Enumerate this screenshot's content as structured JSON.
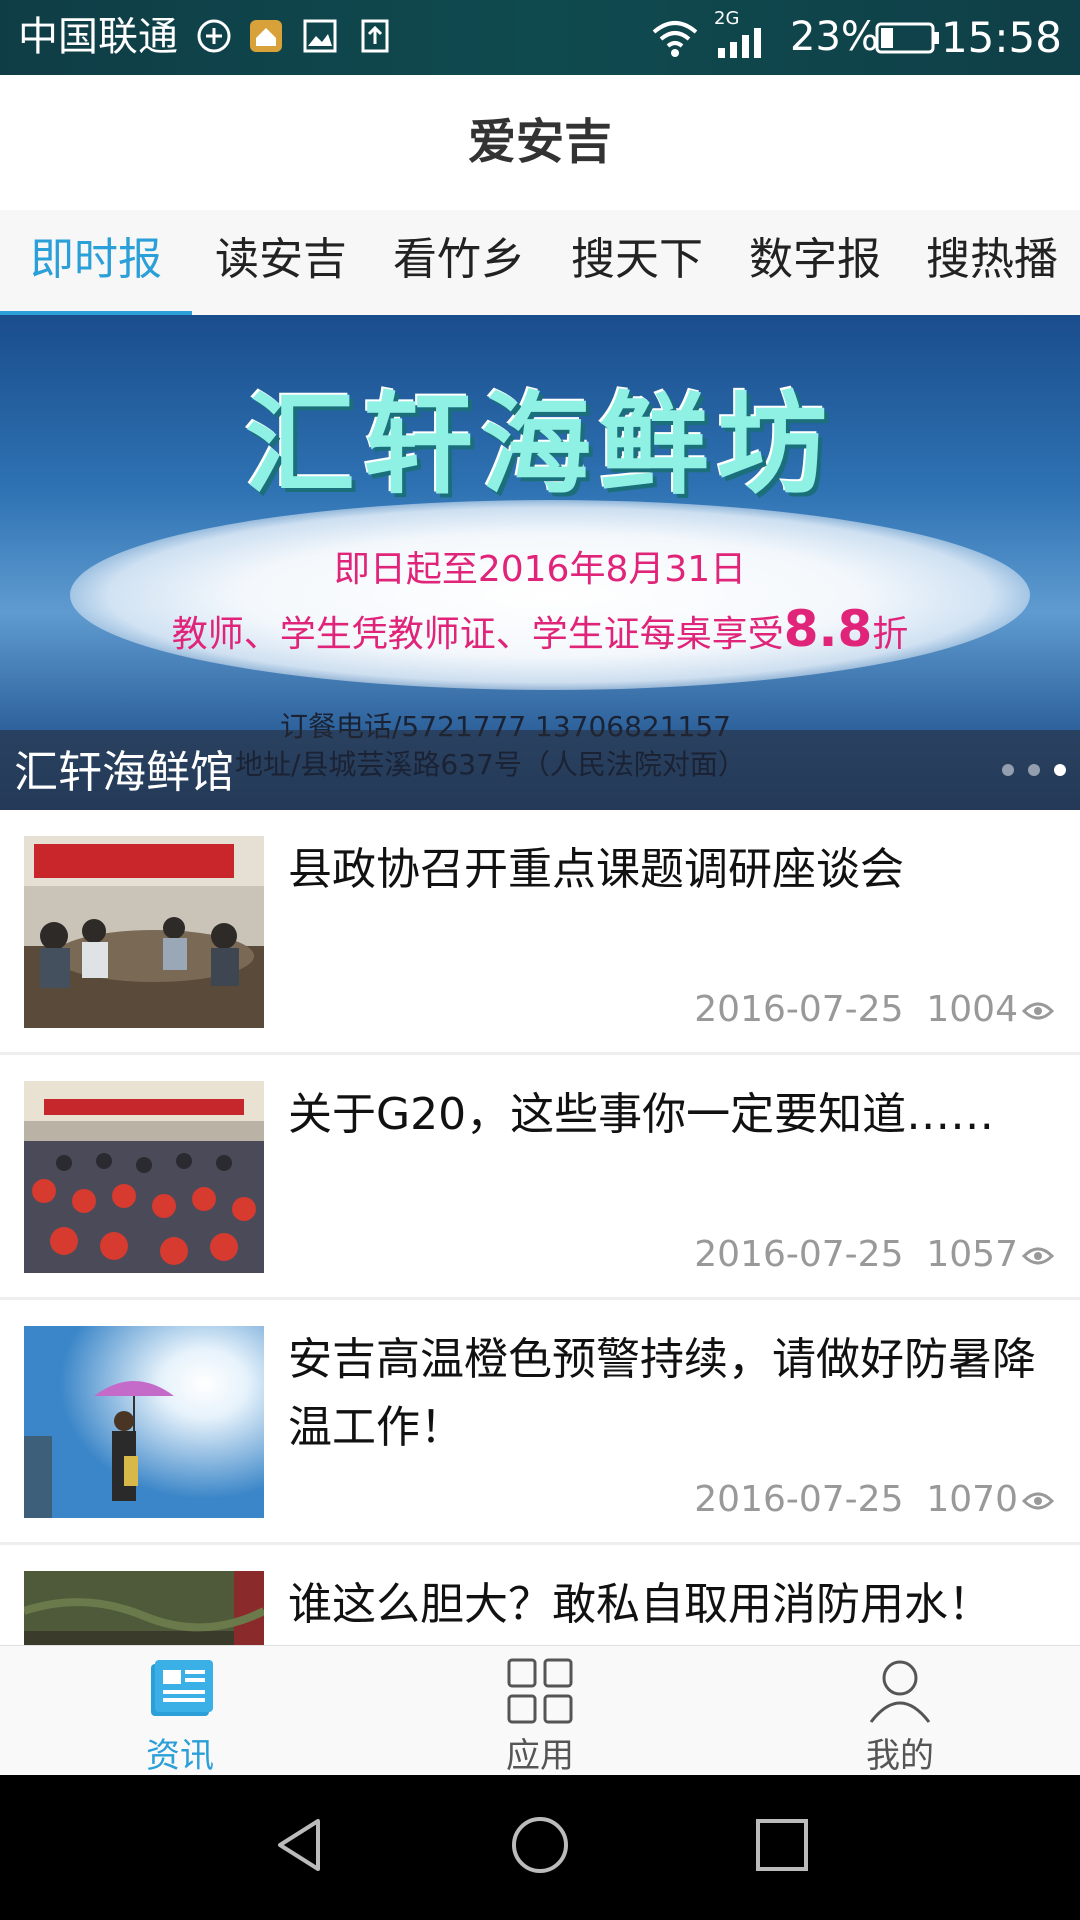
{
  "status_bar": {
    "carrier": "中国联通",
    "network": "2G",
    "battery": "23%",
    "time": "15:58",
    "icons": [
      "sim-icon",
      "home-icon",
      "image-icon",
      "download-icon",
      "wifi-icon",
      "signal-icon",
      "battery-icon"
    ]
  },
  "header": {
    "title": "爱安吉"
  },
  "tabs": [
    {
      "label": "即时报"
    },
    {
      "label": "读安吉"
    },
    {
      "label": "看竹乡"
    },
    {
      "label": "搜天下"
    },
    {
      "label": "数字报"
    },
    {
      "label": "搜热播"
    }
  ],
  "banner": {
    "brand": "汇轩海鲜坊",
    "promo_line1": "即日起至2016年8月31日",
    "promo_line2": "教师、学生凭教师证、学生证每桌享受",
    "promo_discount": "8.8",
    "promo_suffix": "折",
    "phone": "订餐电话/5721777 13706821157",
    "address": "地址/县城芸溪路637号（人民法院对面）",
    "caption": "汇轩海鲜馆",
    "slides": 3,
    "active_slide": 3
  },
  "news": [
    {
      "title": "县政协召开重点课题调研座谈会",
      "date": "2016-07-25",
      "views": "1004",
      "thumb": "meeting-photo"
    },
    {
      "title": "关于G20，这些事你一定要知道……",
      "date": "2016-07-25",
      "views": "1057",
      "thumb": "conference-photo"
    },
    {
      "title": "安吉高温橙色预警持续，请做好防暑降温工作！",
      "date": "2016-07-25",
      "views": "1070",
      "thumb": "sun-umbrella-photo"
    },
    {
      "title": "谁这么胆大？敢私自取用消防用水！",
      "date": "",
      "views": "",
      "thumb": "street-photo"
    }
  ],
  "bottom_nav": [
    {
      "label": "资讯",
      "icon": "news-icon",
      "active": true
    },
    {
      "label": "应用",
      "icon": "apps-grid-icon",
      "active": false
    },
    {
      "label": "我的",
      "icon": "user-icon",
      "active": false
    }
  ],
  "colors": {
    "accent": "#2a9fd8",
    "status_bar": "#0f4a4f",
    "banner_title": "#8ff0e4",
    "banner_promo": "#e0247a"
  }
}
